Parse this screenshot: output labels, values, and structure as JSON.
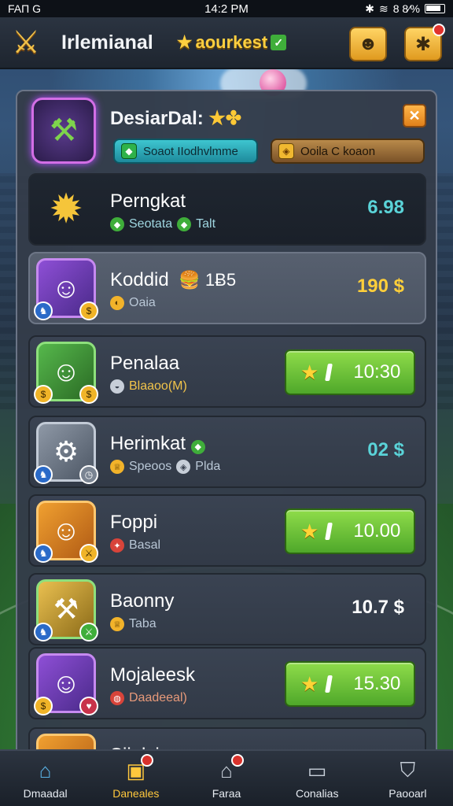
{
  "status_bar": {
    "left": "FAП G",
    "time": "14:2 PM",
    "right": "8 8⁄%"
  },
  "header": {
    "title": "Irlemianal",
    "badge_text": "aourkest",
    "badge_check": "✓"
  },
  "event": {
    "title": "DesiarDal:",
    "close": "✕",
    "pill_left": "Soaot IIodhvlmme",
    "pill_right": "Ooila C koaon"
  },
  "rows": [
    {
      "name": "Perngkat",
      "sub1": "Seotata",
      "sub2": "Talt",
      "price": "6.98"
    },
    {
      "name": "Koddid",
      "extra": "1Ƀ5",
      "sub1": "Oaia",
      "price": "190 $"
    },
    {
      "name": "Penalaa",
      "sub1": "Blaaoo(M)",
      "button": "10:30"
    },
    {
      "name": "Herimkat",
      "sub1": "Speoos",
      "sub2": "Plda",
      "price": "02 $"
    },
    {
      "name": "Foppi",
      "sub1": "Basal",
      "button": "10.00"
    },
    {
      "name": "Baonny",
      "sub1": "Taba",
      "price": "10.7 $"
    },
    {
      "name": "Mojaleesk",
      "sub1": "Daadeeal)",
      "button": "15.30"
    },
    {
      "name": "Siiplsia"
    }
  ],
  "bottom_nav": [
    {
      "label": "Dmaadal"
    },
    {
      "label": "Daneales"
    },
    {
      "label": "Faraa"
    },
    {
      "label": "Conalias"
    },
    {
      "label": "Paooarl"
    }
  ]
}
